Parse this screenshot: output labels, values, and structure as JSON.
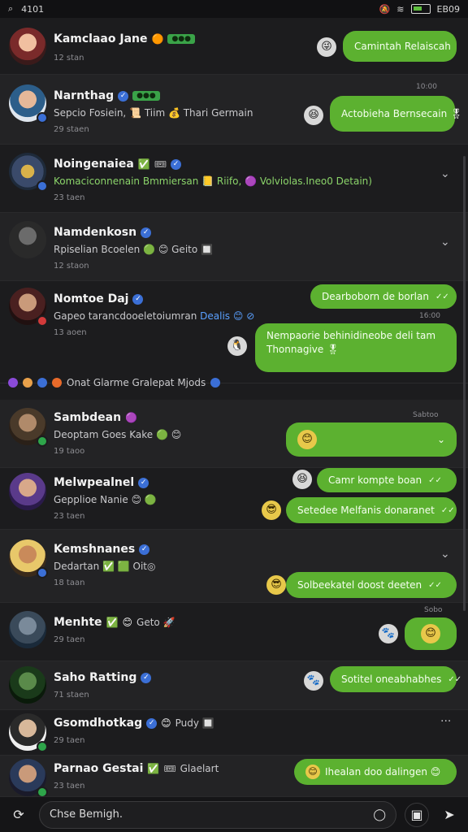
{
  "status_bar": {
    "left_icon": "search-icon",
    "time": "4101",
    "right_text": "EB09"
  },
  "rows": [
    {
      "name": "Kamclaao Jane",
      "badges": [
        "🟠",
        "🟩"
      ],
      "chip": "●●●",
      "time": "12 stan",
      "bubble": "Camintah Relaiscah",
      "emoji": "😜"
    },
    {
      "name": "Narnthag",
      "chip": "●●●",
      "preview": "Sepcio Fosiein, 📜 Tiim 💰 Thari Germain",
      "time": "29 staen",
      "stamp": "10:00",
      "bubble": "Actobieha Bernsecain 🎖",
      "emoji": "😆"
    },
    {
      "name": "Noingenaiea",
      "preview": "Komaciconnenain  Bmmiersan 📒 Riifo, 🟣 Volviolas.Ineo0 Detain)",
      "time": "23 taen"
    },
    {
      "name": "Namdenkosn",
      "preview": "Rpiselian Bcoelen 🟢 😊 Geito 🔲",
      "time": "12 staon"
    },
    {
      "name": "Nomtoe Daj",
      "preview": "Gapeo tarancdooeletoiumran",
      "preview_blue": "Dealis 😊 ⊘",
      "time": "13 aoen",
      "bubble_top": "Dearboborn de borlan",
      "stamp": "16:00",
      "bubble_big": "Nempaorie behinidineobe deli tam Thonnagive 🎖",
      "emoji": "🐧"
    },
    {
      "reactions": "Onat Glarme Gralepat Mjods"
    },
    {
      "name": "Sambdean",
      "preview": "Deoptam Goes Kake 🟢 😊",
      "time": "19 taoo",
      "stamp": "Sabtoo",
      "emoji": "😊"
    },
    {
      "name": "Melwpealnel",
      "preview": "Gepplioe Nanie 😊 🟢",
      "time": "23 taen",
      "bubble_1": "Camr kompte boan",
      "bubble_2": "Setedee Melfanis donaranet",
      "emoji": "😎"
    },
    {
      "name": "Kemshnanes",
      "preview": "Dedartan ✅ 🟩 Oit◎",
      "time": "18 taan",
      "bubble": "Solbeekatel doost deeten",
      "emoji": "😎"
    },
    {
      "name": "Menhte",
      "badges": [
        "✅",
        "😊",
        "Geto 🚀"
      ],
      "time": "29 taen",
      "stamp": "Sobo",
      "emoji": "😊"
    },
    {
      "name": "Saho Ratting",
      "time": "71 staen",
      "bubble": "Sotitel oneabhabhes"
    },
    {
      "name": "Gsomdhotkag",
      "badges": [
        "😊",
        "Pudy 🔲"
      ],
      "time": "29 taen"
    },
    {
      "name": "Parnao Gestai",
      "badges": [
        "✅",
        "😊",
        "Glaelart"
      ],
      "time": "23 taen",
      "bubble": "Ihealan doo dalingen 😊",
      "emoji": "😊"
    }
  ],
  "composer": {
    "placeholder": "Chse Bemigh.",
    "left_icon": "add-attachment-icon",
    "inner_icon": "emoji-icon",
    "media_icon": "image-icon",
    "send_icon": "send-icon"
  },
  "colors": {
    "bubble": "#5cb130",
    "background": "#1c1c1e",
    "verified": "#3b6fd6"
  }
}
